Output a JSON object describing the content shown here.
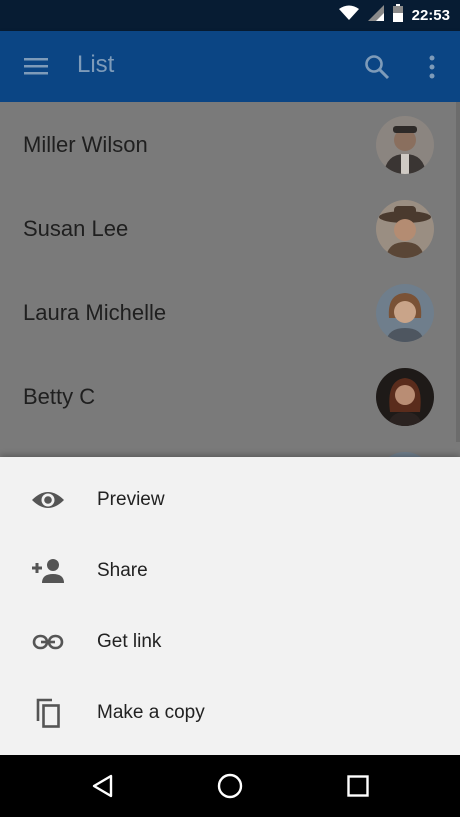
{
  "status_bar": {
    "time": "22:53"
  },
  "app_bar": {
    "title": "List",
    "icons": [
      "menu-icon",
      "search-icon",
      "more-vert-icon"
    ]
  },
  "list": {
    "items": [
      {
        "name": "Miller Wilson"
      },
      {
        "name": "Susan Lee"
      },
      {
        "name": "Laura Michelle"
      },
      {
        "name": "Betty C"
      }
    ]
  },
  "sheet": {
    "items": [
      {
        "label": "Preview",
        "icon": "eye-icon"
      },
      {
        "label": "Share",
        "icon": "person-add-icon"
      },
      {
        "label": "Get link",
        "icon": "link-icon"
      },
      {
        "label": "Make a copy",
        "icon": "copy-icon"
      }
    ]
  },
  "colors": {
    "status_bar": "#071c33",
    "app_bar": "#0b4584",
    "scrim": "#7a7a7a",
    "sheet": "#f2f2f2",
    "nav_bar": "#000000"
  }
}
